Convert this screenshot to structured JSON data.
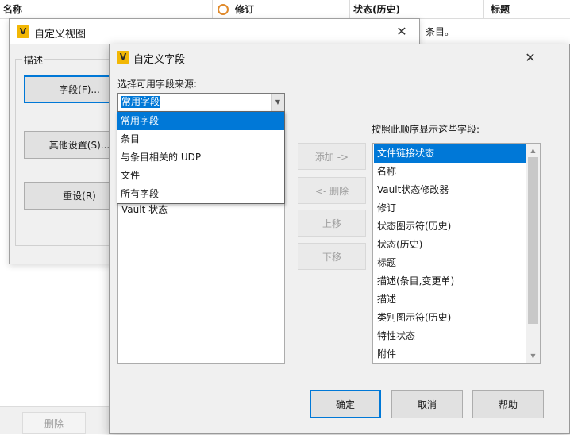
{
  "background": {
    "columns": [
      {
        "label": "名称"
      },
      {
        "label": "修订"
      },
      {
        "label": "状态(历史)"
      },
      {
        "label": "标题"
      }
    ],
    "row_text": "条目。",
    "delete_label": "删除"
  },
  "dialog_custom_view": {
    "title": "自定义视图",
    "group_label": "描述",
    "fields_button": "字段(F)...",
    "other_settings_button": "其他设置(S)...",
    "reset_button": "重设(R)"
  },
  "dialog_custom_fields": {
    "title": "自定义字段",
    "source_label": "选择可用字段来源:",
    "source_selected": "常用字段",
    "source_options": [
      "常用字段",
      "条目",
      "与条目相关的 UDP",
      "文件",
      "所有字段"
    ],
    "available_visible_item": "Vault 状态",
    "order_label": "按照此顺序显示这些字段:",
    "add_button": "添加 ->",
    "remove_button": "<- 删除",
    "move_up_button": "上移",
    "move_down_button": "下移",
    "displayed_fields": [
      "文件链接状态",
      "名称",
      "Vault状态修改器",
      "修订",
      "状态图示符(历史)",
      "状态(历史)",
      "标题",
      "描述(条目,变更单)",
      "描述",
      "类别图示符(历史)",
      "特性状态",
      "附件"
    ],
    "ok_button": "确定",
    "cancel_button": "取消",
    "help_button": "帮助"
  },
  "colors": {
    "accent": "#0078d7",
    "logo": "#f2b705"
  },
  "icons": {
    "logo": "V",
    "close": "✕",
    "combo_arrow": "▼"
  }
}
